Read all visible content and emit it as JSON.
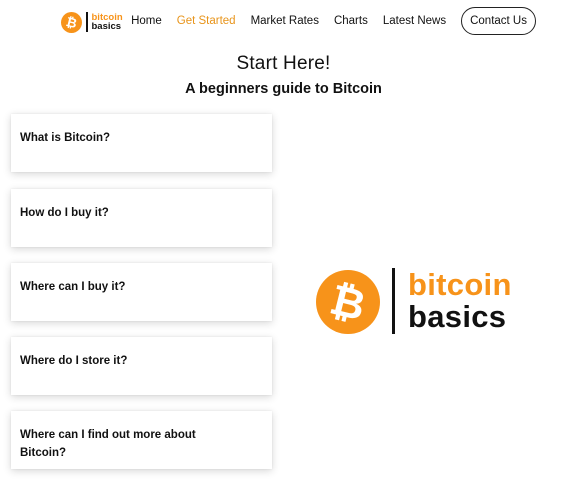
{
  "brand": {
    "line1": "bitcoin",
    "line2": "basics",
    "accent_color": "#f7931a",
    "coin_glyph": "₿"
  },
  "nav": {
    "items": [
      {
        "label": "Home",
        "active": false
      },
      {
        "label": "Get Started",
        "active": true
      },
      {
        "label": "Market Rates",
        "active": false
      },
      {
        "label": "Charts",
        "active": false
      },
      {
        "label": "Latest News",
        "active": false
      }
    ],
    "contact_label": "Contact Us",
    "active_color": "#e8941a"
  },
  "hero": {
    "title": "Start Here!",
    "subtitle": "A beginners guide to Bitcoin"
  },
  "faq": {
    "items": [
      {
        "question": "What is Bitcoin?"
      },
      {
        "question": "How do I buy it?"
      },
      {
        "question": "Where can I buy it?"
      },
      {
        "question": "Where do I store it?"
      },
      {
        "question": "Where can I find out more about Bitcoin?"
      }
    ]
  },
  "icons": {
    "logo_coin": "bitcoin-coin-icon"
  }
}
